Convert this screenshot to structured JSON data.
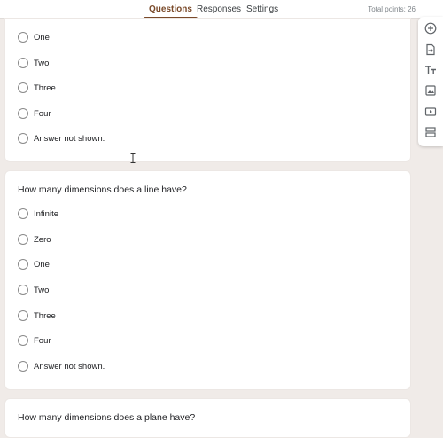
{
  "tabs": [
    {
      "label": "Questions",
      "active": true
    },
    {
      "label": "Responses",
      "active": false
    },
    {
      "label": "Settings",
      "active": false
    }
  ],
  "total_points": "Total points: 26",
  "accent_color": "#7a4a2a",
  "card1": {
    "options": [
      "One",
      "Two",
      "Three",
      "Four",
      "Answer not shown."
    ]
  },
  "card2": {
    "question": "How many dimensions does a line have?",
    "options": [
      "Infinite",
      "Zero",
      "One",
      "Two",
      "Three",
      "Four",
      "Answer not shown."
    ]
  },
  "card3": {
    "question": "How many dimensions does a plane have?"
  },
  "side_tools": [
    {
      "icon": "add-question-icon"
    },
    {
      "icon": "import-questions-icon"
    },
    {
      "icon": "title-text-icon"
    },
    {
      "icon": "add-image-icon"
    },
    {
      "icon": "add-video-icon"
    },
    {
      "icon": "add-section-icon"
    }
  ]
}
